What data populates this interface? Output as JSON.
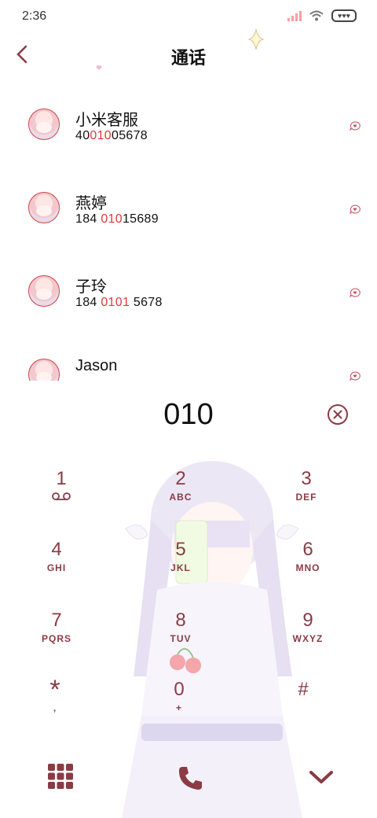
{
  "status_bar": {
    "time": "2:36",
    "battery_icon": "battery-icon"
  },
  "header": {
    "title": "通话",
    "back_icon": "chevron-left-icon"
  },
  "contacts": [
    {
      "name": "小米客服",
      "number_prefix": "40",
      "number_highlight": "010",
      "number_suffix": "05678"
    },
    {
      "name": "燕婷",
      "number_prefix": "184 ",
      "number_highlight": "010",
      "number_suffix": "15689"
    },
    {
      "name": "子玲",
      "number_prefix": "184 ",
      "number_highlight": "0101",
      "number_suffix": " 5678"
    },
    {
      "name": "Jason",
      "number_prefix": "",
      "number_highlight": "",
      "number_suffix": ""
    }
  ],
  "dial": {
    "digits": "010"
  },
  "keys": [
    {
      "digit": "1",
      "letters": ""
    },
    {
      "digit": "2",
      "letters": "ABC"
    },
    {
      "digit": "3",
      "letters": "DEF"
    },
    {
      "digit": "4",
      "letters": "GHI"
    },
    {
      "digit": "5",
      "letters": "JKL"
    },
    {
      "digit": "6",
      "letters": "MNO"
    },
    {
      "digit": "7",
      "letters": "PQRS"
    },
    {
      "digit": "8",
      "letters": "TUV"
    },
    {
      "digit": "9",
      "letters": "WXYZ"
    },
    {
      "digit": "*",
      "letters": ","
    },
    {
      "digit": "0",
      "letters": "+"
    },
    {
      "digit": "#",
      "letters": ""
    }
  ],
  "colors": {
    "accent": "#8a3b44",
    "highlight": "#e33a3a"
  }
}
